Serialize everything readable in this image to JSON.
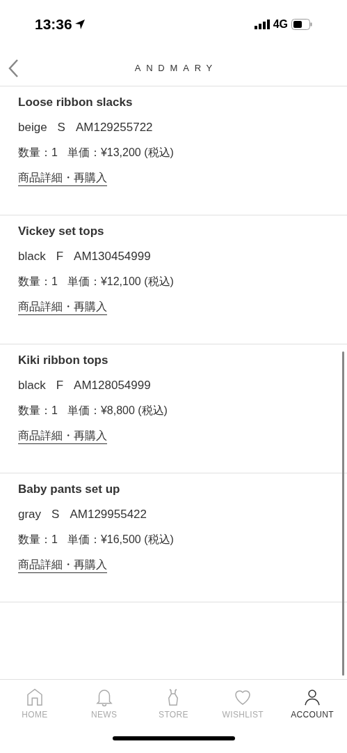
{
  "status_bar": {
    "time": "13:36",
    "network": "4G"
  },
  "header": {
    "logo": "ANDMARY"
  },
  "items": [
    {
      "name": "Loose ribbon slacks",
      "variant": "beige",
      "size": "S",
      "code": "AM129255722",
      "quantity": "数量：1",
      "price": "単価：¥13,200 (税込)",
      "link": "商品詳細・再購入"
    },
    {
      "name": "Vickey set tops",
      "variant": "black",
      "size": "F",
      "code": "AM130454999",
      "quantity": "数量：1",
      "price": "単価：¥12,100 (税込)",
      "link": "商品詳細・再購入"
    },
    {
      "name": "Kiki ribbon tops",
      "variant": "black",
      "size": "F",
      "code": "AM128054999",
      "quantity": "数量：1",
      "price": "単価：¥8,800 (税込)",
      "link": "商品詳細・再購入"
    },
    {
      "name": "Baby pants set up",
      "variant": "gray",
      "size": "S",
      "code": "AM129955422",
      "quantity": "数量：1",
      "price": "単価：¥16,500 (税込)",
      "link": "商品詳細・再購入"
    }
  ],
  "tab_bar": [
    {
      "kind": "home",
      "label": "HOME",
      "selected": false
    },
    {
      "kind": "news",
      "label": "NEWS",
      "selected": false
    },
    {
      "kind": "store",
      "label": "STORE",
      "selected": false
    },
    {
      "kind": "wishlist",
      "label": "WISHLIST",
      "selected": false
    },
    {
      "kind": "account",
      "label": "ACCOUNT",
      "selected": true
    }
  ]
}
